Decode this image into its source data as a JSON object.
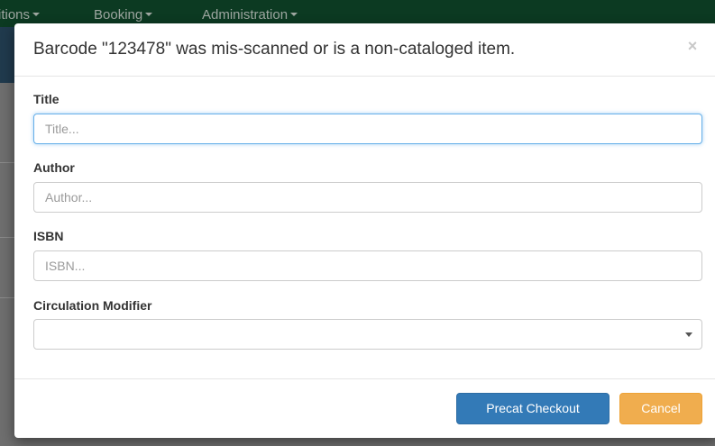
{
  "background_nav": {
    "items": [
      {
        "label": "itions"
      },
      {
        "label": "Booking"
      },
      {
        "label": "Administration"
      }
    ]
  },
  "modal": {
    "title": "Barcode \"123478\" was mis-scanned or is a non-cataloged item.",
    "close_symbol": "×",
    "fields": {
      "title": {
        "label": "Title",
        "placeholder": "Title...",
        "value": ""
      },
      "author": {
        "label": "Author",
        "placeholder": "Author...",
        "value": ""
      },
      "isbn": {
        "label": "ISBN",
        "placeholder": "ISBN...",
        "value": ""
      },
      "circ_modifier": {
        "label": "Circulation Modifier",
        "selected": ""
      }
    },
    "buttons": {
      "precat_checkout": "Precat Checkout",
      "cancel": "Cancel"
    }
  },
  "colors": {
    "primary": "#337ab7",
    "warning": "#f0ad4e",
    "navbar": "#0c3a22",
    "focus": "#66afe9"
  },
  "icons": {
    "close": "close-icon",
    "caret": "caret-down-icon"
  }
}
